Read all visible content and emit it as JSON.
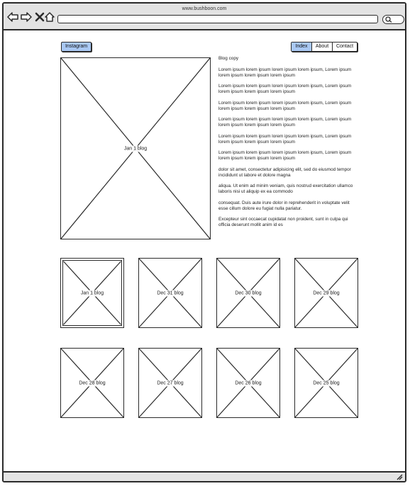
{
  "browser": {
    "url": "www.bushboon.com",
    "icons": [
      "back-arrow-icon",
      "forward-arrow-icon",
      "close-icon",
      "home-icon",
      "search-icon",
      "resize-grip-icon"
    ]
  },
  "header": {
    "instagram_label": "Instagram",
    "nav": {
      "index": "Index",
      "about": "About",
      "contact": "Contact",
      "active": "Index"
    }
  },
  "featured": {
    "label": "Jan 1 blog"
  },
  "blog": {
    "title": "Blog copy",
    "paragraphs": [
      "Lorem ipsum lorem ipsum lorem ipsum lorem ipsum, Lorem ipsum lorem ipsum lorem ipsum lorem ipsum",
      "Lorem ipsum lorem ipsum lorem ipsum lorem ipsum, Lorem ipsum lorem ipsum lorem ipsum lorem ipsum",
      "Lorem ipsum lorem ipsum lorem ipsum lorem ipsum, Lorem ipsum lorem ipsum lorem ipsum lorem ipsum",
      "Lorem ipsum lorem ipsum lorem ipsum lorem ipsum, Lorem ipsum lorem ipsum lorem ipsum lorem ipsum",
      "Lorem ipsum lorem ipsum lorem ipsum lorem ipsum, Lorem ipsum lorem ipsum lorem ipsum lorem ipsum",
      "Lorem ipsum lorem ipsum lorem ipsum lorem ipsum, Lorem ipsum lorem ipsum lorem ipsum lorem ipsum",
      "dolor sit amet, consectetur adipisicing elit, sed do eiusmod tempor incididunt ut labore et dolore magna",
      "aliqua. Ut enim ad minim veniam, quis nostrud exercitation ullamco laboris nisi ut aliquip ex ea commodo",
      "consequat. Duis aute irure dolor in reprehenderit in voluptate velit esse cillum dolore eu fugiat nulla pariatur.",
      "Excepteur sint occaecat cupidatat non proident, sunt in culpa qui officia deserunt mollit anim id es"
    ]
  },
  "thumbnails": [
    {
      "label": "Jan 1 blog",
      "selected": true
    },
    {
      "label": "Dec 31 blog"
    },
    {
      "label": "Dec 30 blog"
    },
    {
      "label": "Dec 29 blog"
    },
    {
      "label": "Dec 28 blog"
    },
    {
      "label": "Dec 27 blog"
    },
    {
      "label": "Dec 26 blog"
    },
    {
      "label": "Dec 25 blog"
    }
  ]
}
